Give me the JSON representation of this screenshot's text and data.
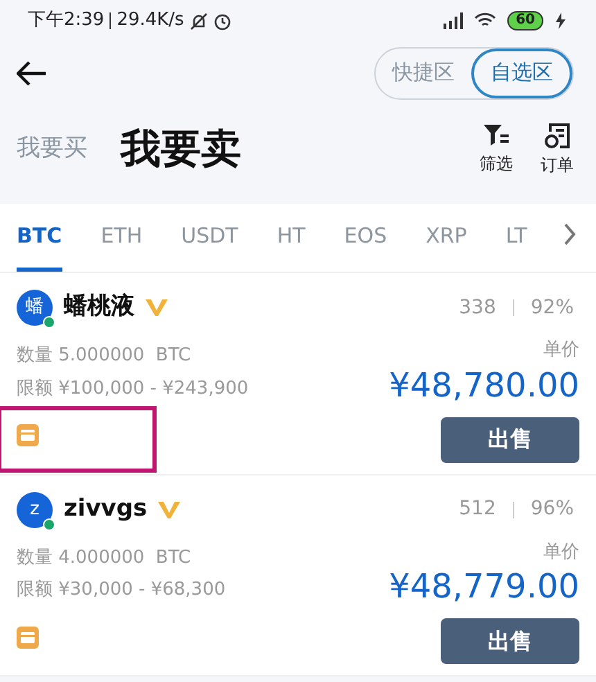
{
  "status_bar": {
    "time": "下午2:39",
    "speed": "29.4K/s",
    "battery": "60"
  },
  "segment": [
    {
      "label": "快捷区",
      "selected": false
    },
    {
      "label": "自选区",
      "selected": true
    }
  ],
  "modes": [
    {
      "label": "我要买",
      "selected": false
    },
    {
      "label": "我要卖",
      "selected": true
    }
  ],
  "actions": [
    {
      "kind": "filter",
      "label": "筛选"
    },
    {
      "kind": "orders",
      "label": "订单"
    }
  ],
  "tabs": [
    {
      "label": "BTC",
      "selected": true
    },
    {
      "label": "ETH",
      "selected": false
    },
    {
      "label": "USDT",
      "selected": false
    },
    {
      "label": "HT",
      "selected": false
    },
    {
      "label": "EOS",
      "selected": false
    },
    {
      "label": "XRP",
      "selected": false
    },
    {
      "label": "LT",
      "selected": false
    }
  ],
  "offers": [
    {
      "avatar": "蟠",
      "name": "蟠桃液",
      "orders": "338",
      "rate": "92%",
      "quantity": "数量 5.000000  BTC",
      "limit": "限额 ¥100,000 - ¥243,900",
      "price_label": "单价",
      "price": "¥48,780.00",
      "button": "出售",
      "highlighted": true
    },
    {
      "avatar": "z",
      "name": "zivvgs",
      "orders": "512",
      "rate": "96%",
      "quantity": "数量 4.000000  BTC",
      "limit": "限额 ¥30,000 - ¥68,300",
      "price_label": "单价",
      "price": "¥48,779.00",
      "button": "出售",
      "highlighted": false
    }
  ]
}
